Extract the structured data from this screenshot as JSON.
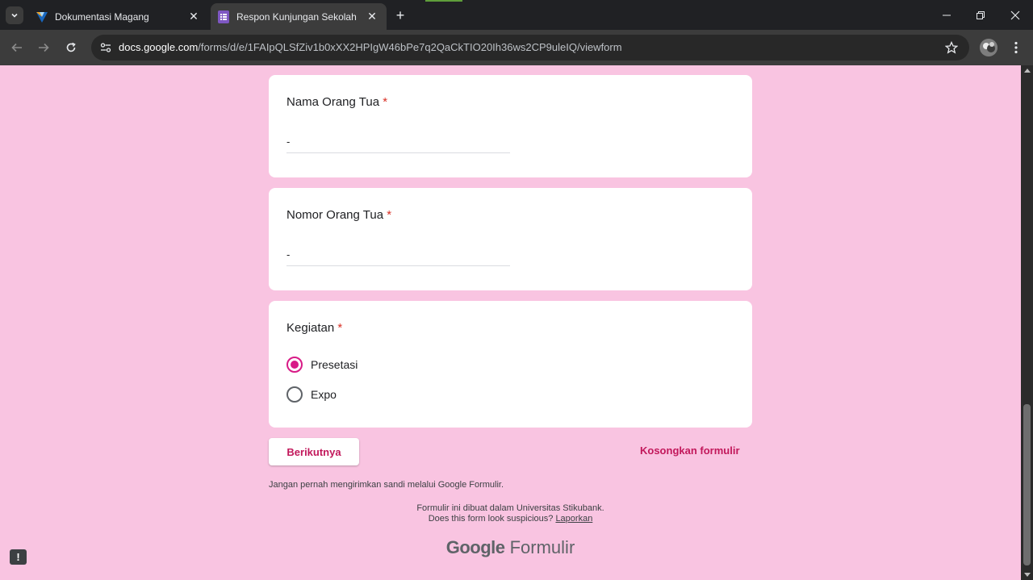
{
  "browser": {
    "tabs": [
      {
        "label": "Dokumentasi Magang",
        "icon": "vuetify-logo-icon",
        "active": false
      },
      {
        "label": "Respon Kunjungan Sekolah",
        "icon": "google-forms-icon",
        "active": true
      }
    ],
    "url_host": "docs.google.com",
    "url_path": "/forms/d/e/1FAIpQLSfZiv1b0xXX2HPIgW46bPe7q2QaCkTIO20Ih36ws2CP9uleIQ/viewform"
  },
  "form": {
    "questions": [
      {
        "title": "Nama Orang Tua",
        "required_mark": "*",
        "answer": "-"
      },
      {
        "title": "Nomor Orang Tua",
        "required_mark": "*",
        "answer": "-"
      },
      {
        "title": "Kegiatan",
        "required_mark": "*",
        "options": [
          {
            "label": "Presetasi",
            "selected": true
          },
          {
            "label": "Expo",
            "selected": false
          }
        ]
      }
    ],
    "next_label": "Berikutnya",
    "clear_label": "Kosongkan formulir",
    "password_note": "Jangan pernah mengirimkan sandi melalui Google Formulir."
  },
  "footer": {
    "created_in": "Formulir ini dibuat dalam Universitas Stikubank.",
    "suspicious": "Does this form look suspicious?",
    "report_link": "Laporkan",
    "brand_google": "Google",
    "brand_product": "Formulir"
  },
  "colors": {
    "background": "#f9c4e1",
    "accent": "#c2185b",
    "required": "#d93025"
  }
}
